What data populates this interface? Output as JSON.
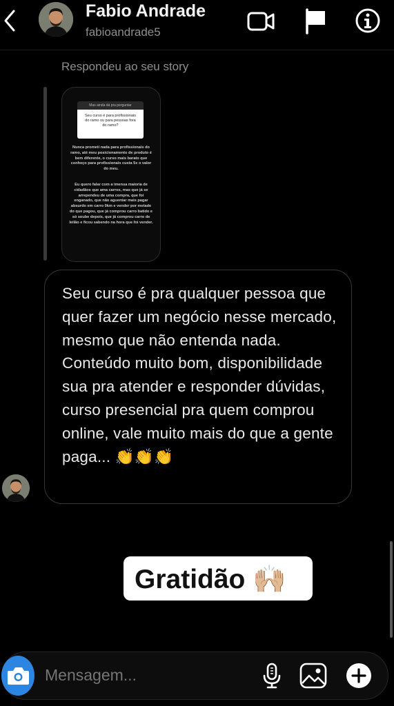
{
  "header": {
    "name": "Fabio Andrade",
    "username": "fabioandrade5",
    "icons": [
      "chevron-left-icon",
      "video-call-icon",
      "flag-icon",
      "info-icon"
    ]
  },
  "thread": {
    "story_reply_label": "Respondeu ao seu story",
    "story": {
      "top_label": "Mas ainda dá pra perguntar",
      "question": "Seu curso é para profissionais do ramo ou para pessoas fora do ramo?",
      "answer_1": "Nunca prometi nada para profissionais do ramo, até meu posicionamento de produto é bem diferente, o curso mais barato que conheço para profissionais custa 5x o valor do meu.",
      "answer_2": "Eu quero falar com a imensa maioria de cidadãos que ama carros, mas que já se arrependeu de uma compra, que foi enganado, que não aguentar mais pagar absurdo em carro 0km e vender por metade do que pagou, que já comprou carro batido e só soube depois, que já comprou carro de leilão e ficou sabendo na hora que foi vender."
    },
    "message": "Seu curso é pra qualquer pessoa que quer fazer um negócio nesse mercado, mesmo que não entenda nada. Conteúdo muito bom, disponibilidade sua pra atender e responder dúvidas, curso presencial pra quem comprou online, vale muito mais do que a gente paga... 👏👏👏",
    "sticker": "Gratidão 🙌🏼"
  },
  "composer": {
    "placeholder": "Mensagem...",
    "icons": [
      "camera-icon",
      "microphone-icon",
      "gallery-icon",
      "add-icon"
    ]
  },
  "colors": {
    "background": "#000000",
    "camera_button": "#2c85e0",
    "secondary_text": "#8e8e8e"
  }
}
